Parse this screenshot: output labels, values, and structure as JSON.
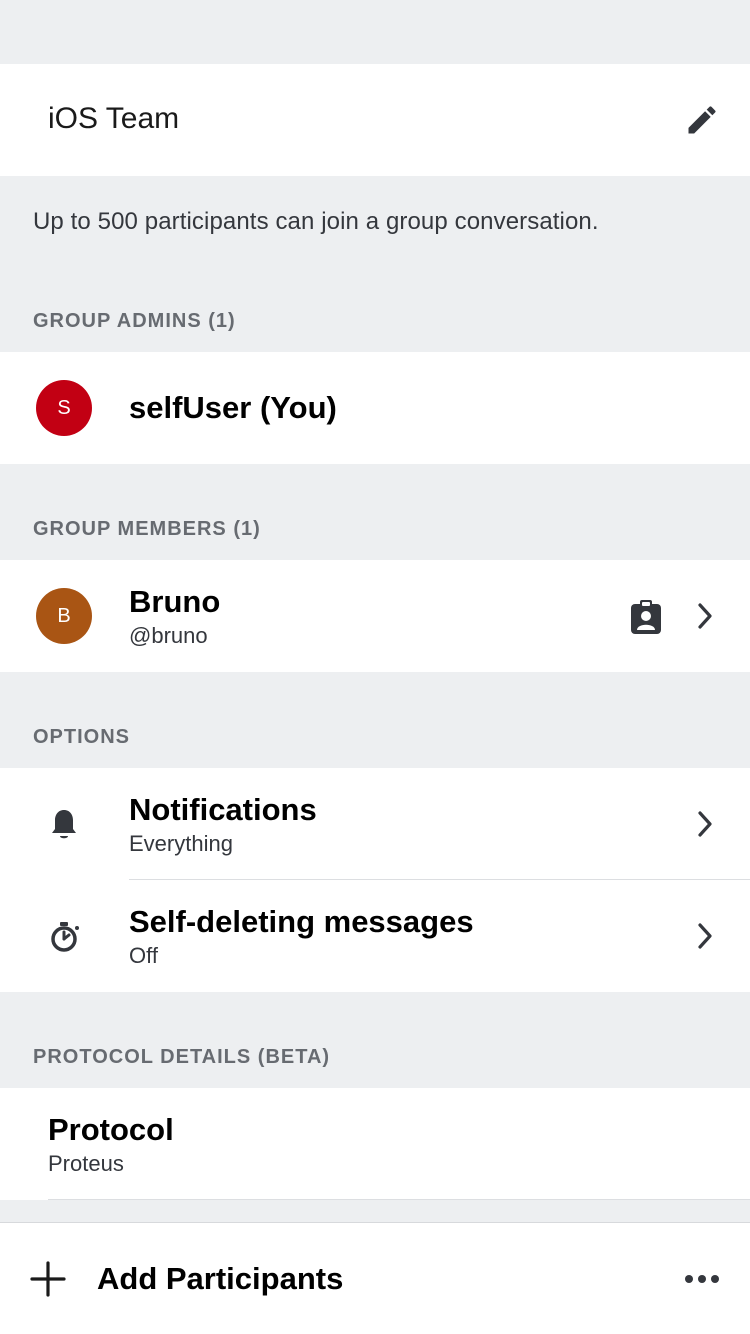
{
  "conversation": {
    "name": "iOS Team",
    "capacity_note": "Up to 500 participants can join a group conversation."
  },
  "admins": {
    "header": "GROUP ADMINS (1)",
    "items": [
      {
        "initial": "S",
        "name": "selfUser (You)",
        "color": "#C20013"
      }
    ]
  },
  "members": {
    "header": "GROUP MEMBERS (1)",
    "items": [
      {
        "initial": "B",
        "name": "Bruno",
        "handle": "@bruno",
        "color": "#A95514"
      }
    ]
  },
  "options": {
    "header": "OPTIONS",
    "notifications": {
      "title": "Notifications",
      "value": "Everything"
    },
    "self_deleting": {
      "title": "Self-deleting messages",
      "value": "Off"
    }
  },
  "protocol": {
    "header": "PROTOCOL DETAILS (BETA)",
    "title": "Protocol",
    "value": "Proteus"
  },
  "footer": {
    "add_label": "Add Participants"
  },
  "icons": {
    "edit": "pencil-icon",
    "member_badge": "contact-card-icon",
    "notifications": "bell-icon",
    "self_deleting": "timer-icon",
    "add": "plus-icon",
    "more": "ellipsis-icon",
    "chevron": "chevron-right-icon"
  },
  "colors": {
    "background": "#EDEFF1",
    "cell": "#FFFFFF",
    "section_header": "#676B71"
  }
}
